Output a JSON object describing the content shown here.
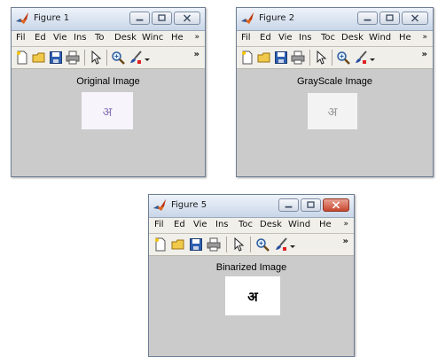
{
  "menu_labels": [
    "Fil",
    "Ed",
    "Vie",
    "Ins",
    "Too",
    "Desk",
    "Wind",
    "He"
  ],
  "menu_more": "»",
  "toolbar_more": "»",
  "windows": [
    {
      "title": "Figure 1",
      "menu": [
        "Fil",
        "Ed",
        "Vie",
        "Ins",
        "To",
        "Desk",
        "Winc",
        "He"
      ],
      "axes_title": "Original Image",
      "glyph_color": "#8a78b8",
      "image_bg": "#f7f4fb",
      "close_active": false
    },
    {
      "title": "Figure 2",
      "menu": [
        "Fil",
        "Ed",
        "Vie",
        "Ins",
        "Toc",
        "Desk",
        "Wind",
        "He"
      ],
      "axes_title": "GrayScale Image",
      "glyph_color": "#9a9a9a",
      "image_bg": "#f3f3f3",
      "close_active": false
    },
    {
      "title": "Figure 5",
      "menu": [
        "Fil",
        "Ed",
        "Vie",
        "Ins",
        "Toc",
        "Desk",
        "Wind",
        "He"
      ],
      "axes_title": "Binarized Image",
      "glyph_color": "#000000",
      "image_bg": "#ffffff",
      "close_active": true
    }
  ]
}
